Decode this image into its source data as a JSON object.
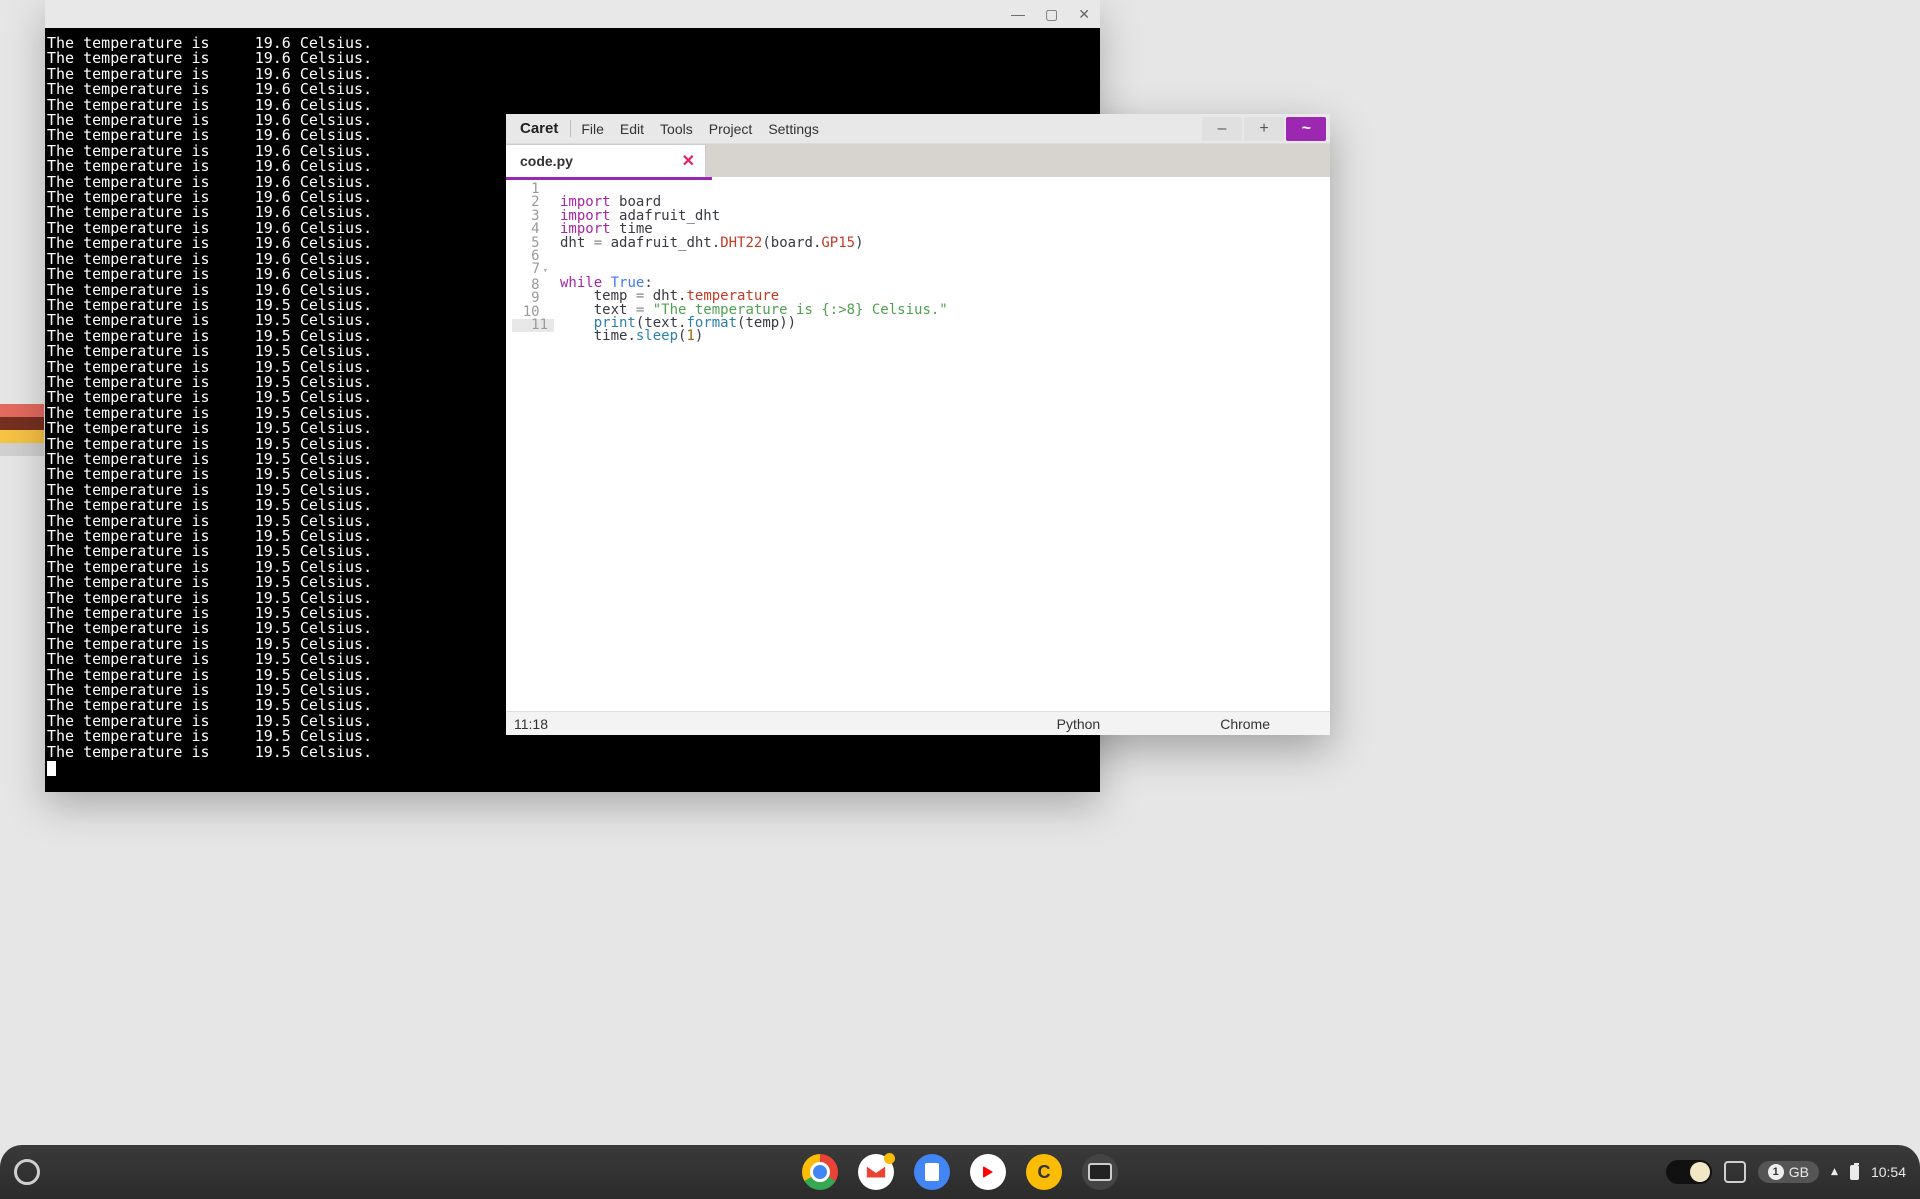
{
  "terminal": {
    "window_buttons": {
      "min": "—",
      "max": "▢",
      "close": "✕"
    },
    "lines": [
      "The temperature is     19.6 Celsius.",
      "The temperature is     19.6 Celsius.",
      "The temperature is     19.6 Celsius.",
      "The temperature is     19.6 Celsius.",
      "The temperature is     19.6 Celsius.",
      "The temperature is     19.6 Celsius.",
      "The temperature is     19.6 Celsius.",
      "The temperature is     19.6 Celsius.",
      "The temperature is     19.6 Celsius.",
      "The temperature is     19.6 Celsius.",
      "The temperature is     19.6 Celsius.",
      "The temperature is     19.6 Celsius.",
      "The temperature is     19.6 Celsius.",
      "The temperature is     19.6 Celsius.",
      "The temperature is     19.6 Celsius.",
      "The temperature is     19.6 Celsius.",
      "The temperature is     19.6 Celsius.",
      "The temperature is     19.5 Celsius.",
      "The temperature is     19.5 Celsius.",
      "The temperature is     19.5 Celsius.",
      "The temperature is     19.5 Celsius.",
      "The temperature is     19.5 Celsius.",
      "The temperature is     19.5 Celsius.",
      "The temperature is     19.5 Celsius.",
      "The temperature is     19.5 Celsius.",
      "The temperature is     19.5 Celsius.",
      "The temperature is     19.5 Celsius.",
      "The temperature is     19.5 Celsius.",
      "The temperature is     19.5 Celsius.",
      "The temperature is     19.5 Celsius.",
      "The temperature is     19.5 Celsius.",
      "The temperature is     19.5 Celsius.",
      "The temperature is     19.5 Celsius.",
      "The temperature is     19.5 Celsius.",
      "The temperature is     19.5 Celsius.",
      "The temperature is     19.5 Celsius.",
      "The temperature is     19.5 Celsius.",
      "The temperature is     19.5 Celsius.",
      "The temperature is     19.5 Celsius.",
      "The temperature is     19.5 Celsius.",
      "The temperature is     19.5 Celsius.",
      "The temperature is     19.5 Celsius.",
      "The temperature is     19.5 Celsius.",
      "The temperature is     19.5 Celsius.",
      "The temperature is     19.5 Celsius.",
      "The temperature is     19.5 Celsius.",
      "The temperature is     19.5 Celsius."
    ]
  },
  "editor": {
    "brand": "Caret",
    "menu": [
      "File",
      "Edit",
      "Tools",
      "Project",
      "Settings"
    ],
    "titlebar_buttons": {
      "minus": "–",
      "plus": "+",
      "tilde": "~"
    },
    "tab": {
      "name": "code.py",
      "close": "✕"
    },
    "gutter": [
      "1",
      "2",
      "3",
      "4",
      "5",
      "6",
      "7",
      "8",
      "9",
      "10",
      "11"
    ],
    "code": {
      "l1_import": "import",
      "l1_mod": "board",
      "l2_import": "import",
      "l2_mod": "adafruit_dht",
      "l3_import": "import",
      "l3_mod": "time",
      "l4_var": "dht",
      "l4_eq": " = ",
      "l4_mod": "adafruit_dht",
      "l4_dot1": ".",
      "l4_cls": "DHT22",
      "l4_p1": "(",
      "l4_arg1": "board",
      "l4_dot2": ".",
      "l4_arg2": "GP15",
      "l4_p2": ")",
      "l7_while": "while",
      "l7_true": "True",
      "l7_colon": ":",
      "l8_var": "temp",
      "l8_eq": " = ",
      "l8_obj": "dht",
      "l8_dot": ".",
      "l8_attr": "temperature",
      "l9_var": "text",
      "l9_eq": " = ",
      "l9_str": "\"The temperature is {:>8} Celsius.\"",
      "l10_fn": "print",
      "l10_p1": "(",
      "l10_obj": "text",
      "l10_dot": ".",
      "l10_m": "format",
      "l10_p2": "(",
      "l10_arg": "temp",
      "l10_p3": "))",
      "l11_obj": "time",
      "l11_dot": ".",
      "l11_m": "sleep",
      "l11_p1": "(",
      "l11_arg": "1",
      "l11_p2": ")"
    },
    "status": {
      "cursor": "11:18",
      "language": "Python",
      "platform": "Chrome"
    }
  },
  "shelf": {
    "apps": [
      "chrome",
      "gmail",
      "docs",
      "youtube",
      "caret",
      "terminal"
    ],
    "caret_letter": "C",
    "disk": {
      "amount": "1",
      "unit": "GB"
    },
    "clock": "10:54"
  }
}
